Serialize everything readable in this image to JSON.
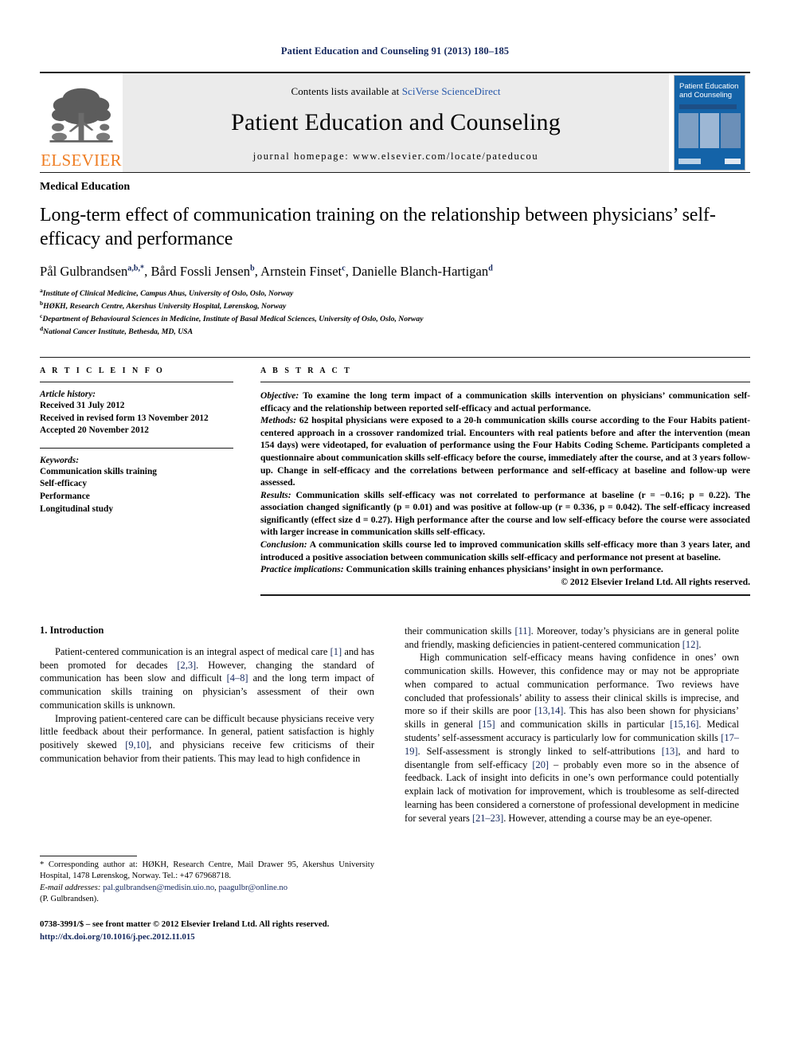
{
  "running_head": "Patient Education and Counseling 91 (2013) 180–185",
  "masthead": {
    "contents_prefix": "Contents lists available at ",
    "contents_link": "SciVerse ScienceDirect",
    "journal_title": "Patient Education and Counseling",
    "homepage": "journal homepage: www.elsevier.com/locate/pateducou",
    "publisher_logo_text": "ELSEVIER",
    "cover_title_line1": "Patient Education",
    "cover_title_line2": "and Counseling"
  },
  "article": {
    "kicker": "Medical Education",
    "title": "Long-term effect of communication training on the relationship between physicians’ self-efficacy and performance",
    "authors_html": "Pål Gulbrandsen<sup>a,b,*</sup>, Bård Fossli Jensen<sup>b</sup>, Arnstein Finset<sup>c</sup>, Danielle Blanch-Hartigan<sup>d</sup>",
    "affiliations": [
      {
        "marker": "a",
        "text": "Institute of Clinical Medicine, Campus Ahus, University of Oslo, Oslo, Norway"
      },
      {
        "marker": "b",
        "text": "HØKH, Research Centre, Akershus University Hospital, Lørenskog, Norway"
      },
      {
        "marker": "c",
        "text": "Department of Behavioural Sciences in Medicine, Institute of Basal Medical Sciences, University of Oslo, Oslo, Norway"
      },
      {
        "marker": "d",
        "text": "National Cancer Institute, Bethesda, MD, USA"
      }
    ]
  },
  "article_info": {
    "heading": "A R T I C L E   I N F O",
    "history_label": "Article history:",
    "history": [
      "Received 31 July 2012",
      "Received in revised form 13 November 2012",
      "Accepted 20 November 2012"
    ],
    "keywords_label": "Keywords:",
    "keywords": [
      "Communication skills training",
      "Self-efficacy",
      "Performance",
      "Longitudinal study"
    ]
  },
  "abstract": {
    "heading": "A B S T R A C T",
    "objective_label": "Objective:",
    "objective_text": " To examine the long term impact of a communication skills intervention on physicians’ communication self-efficacy and the relationship between reported self-efficacy and actual performance.",
    "methods_label": "Methods:",
    "methods_text": " 62 hospital physicians were exposed to a 20-h communication skills course according to the Four Habits patient-centered approach in a crossover randomized trial. Encounters with real patients before and after the intervention (mean 154 days) were videotaped, for evaluation of performance using the Four Habits Coding Scheme. Participants completed a questionnaire about communication skills self-efficacy before the course, immediately after the course, and at 3 years follow-up. Change in self-efficacy and the correlations between performance and self-efficacy at baseline and follow-up were assessed.",
    "results_label": "Results:",
    "results_text": " Communication skills self-efficacy was not correlated to performance at baseline (r = −0.16; p = 0.22). The association changed significantly (p = 0.01) and was positive at follow-up (r = 0.336, p = 0.042). The self-efficacy increased significantly (effect size d = 0.27). High performance after the course and low self-efficacy before the course were associated with larger increase in communication skills self-efficacy.",
    "conclusion_label": "Conclusion:",
    "conclusion_text": " A communication skills course led to improved communication skills self-efficacy more than 3 years later, and introduced a positive association between communication skills self-efficacy and performance not present at baseline.",
    "practice_label": "Practice implications:",
    "practice_text": " Communication skills training enhances physicians’ insight in own performance.",
    "copyright": "© 2012 Elsevier Ireland Ltd. All rights reserved."
  },
  "introduction": {
    "heading": "1. Introduction",
    "left_paragraphs": [
      "Patient-centered communication is an integral aspect of medical care [1] and has been promoted for decades [2,3]. However, changing the standard of communication has been slow and difficult [4–8] and the long term impact of communication skills training on physician’s assessment of their own communication skills is unknown.",
      "Improving patient-centered care can be difficult because physicians receive very little feedback about their performance. In general, patient satisfaction is highly positively skewed [9,10], and physicians receive few criticisms of their communication behavior from their patients. This may lead to high confidence in"
    ],
    "right_paragraphs": [
      "their communication skills [11]. Moreover, today’s physicians are in general polite and friendly, masking deficiencies in patient-centered communication [12].",
      "High communication self-efficacy means having confidence in ones’ own communication skills. However, this confidence may or may not be appropriate when compared to actual communication performance. Two reviews have concluded that professionals’ ability to assess their clinical skills is imprecise, and more so if their skills are poor [13,14]. This has also been shown for physicians’ skills in general [15] and communication skills in particular [15,16]. Medical students’ self-assessment accuracy is particularly low for communication skills [17–19]. Self-assessment is strongly linked to self-attributions [13], and hard to disentangle from self-efficacy [20] – probably even more so in the absence of feedback. Lack of insight into deficits in one’s own performance could potentially explain lack of motivation for improvement, which is troublesome as self-directed learning has been considered a cornerstone of professional development in medicine for several years [21–23]. However, attending a course may be an eye-opener."
    ]
  },
  "footnotes": {
    "corresponding": "* Corresponding author at: HØKH, Research Centre, Mail Drawer 95, Akershus University Hospital, 1478 Lørenskog, Norway. Tel.: +47 67968718.",
    "email_label": "E-mail addresses:",
    "email_1": "pal.gulbrandsen@medisin.uio.no",
    "email_2": "paagulbr@online.no",
    "email_owner": "(P. Gulbrandsen).",
    "issn_line": "0738-3991/$ – see front matter © 2012 Elsevier Ireland Ltd. All rights reserved.",
    "doi": "http://dx.doi.org/10.1016/j.pec.2012.11.015"
  }
}
